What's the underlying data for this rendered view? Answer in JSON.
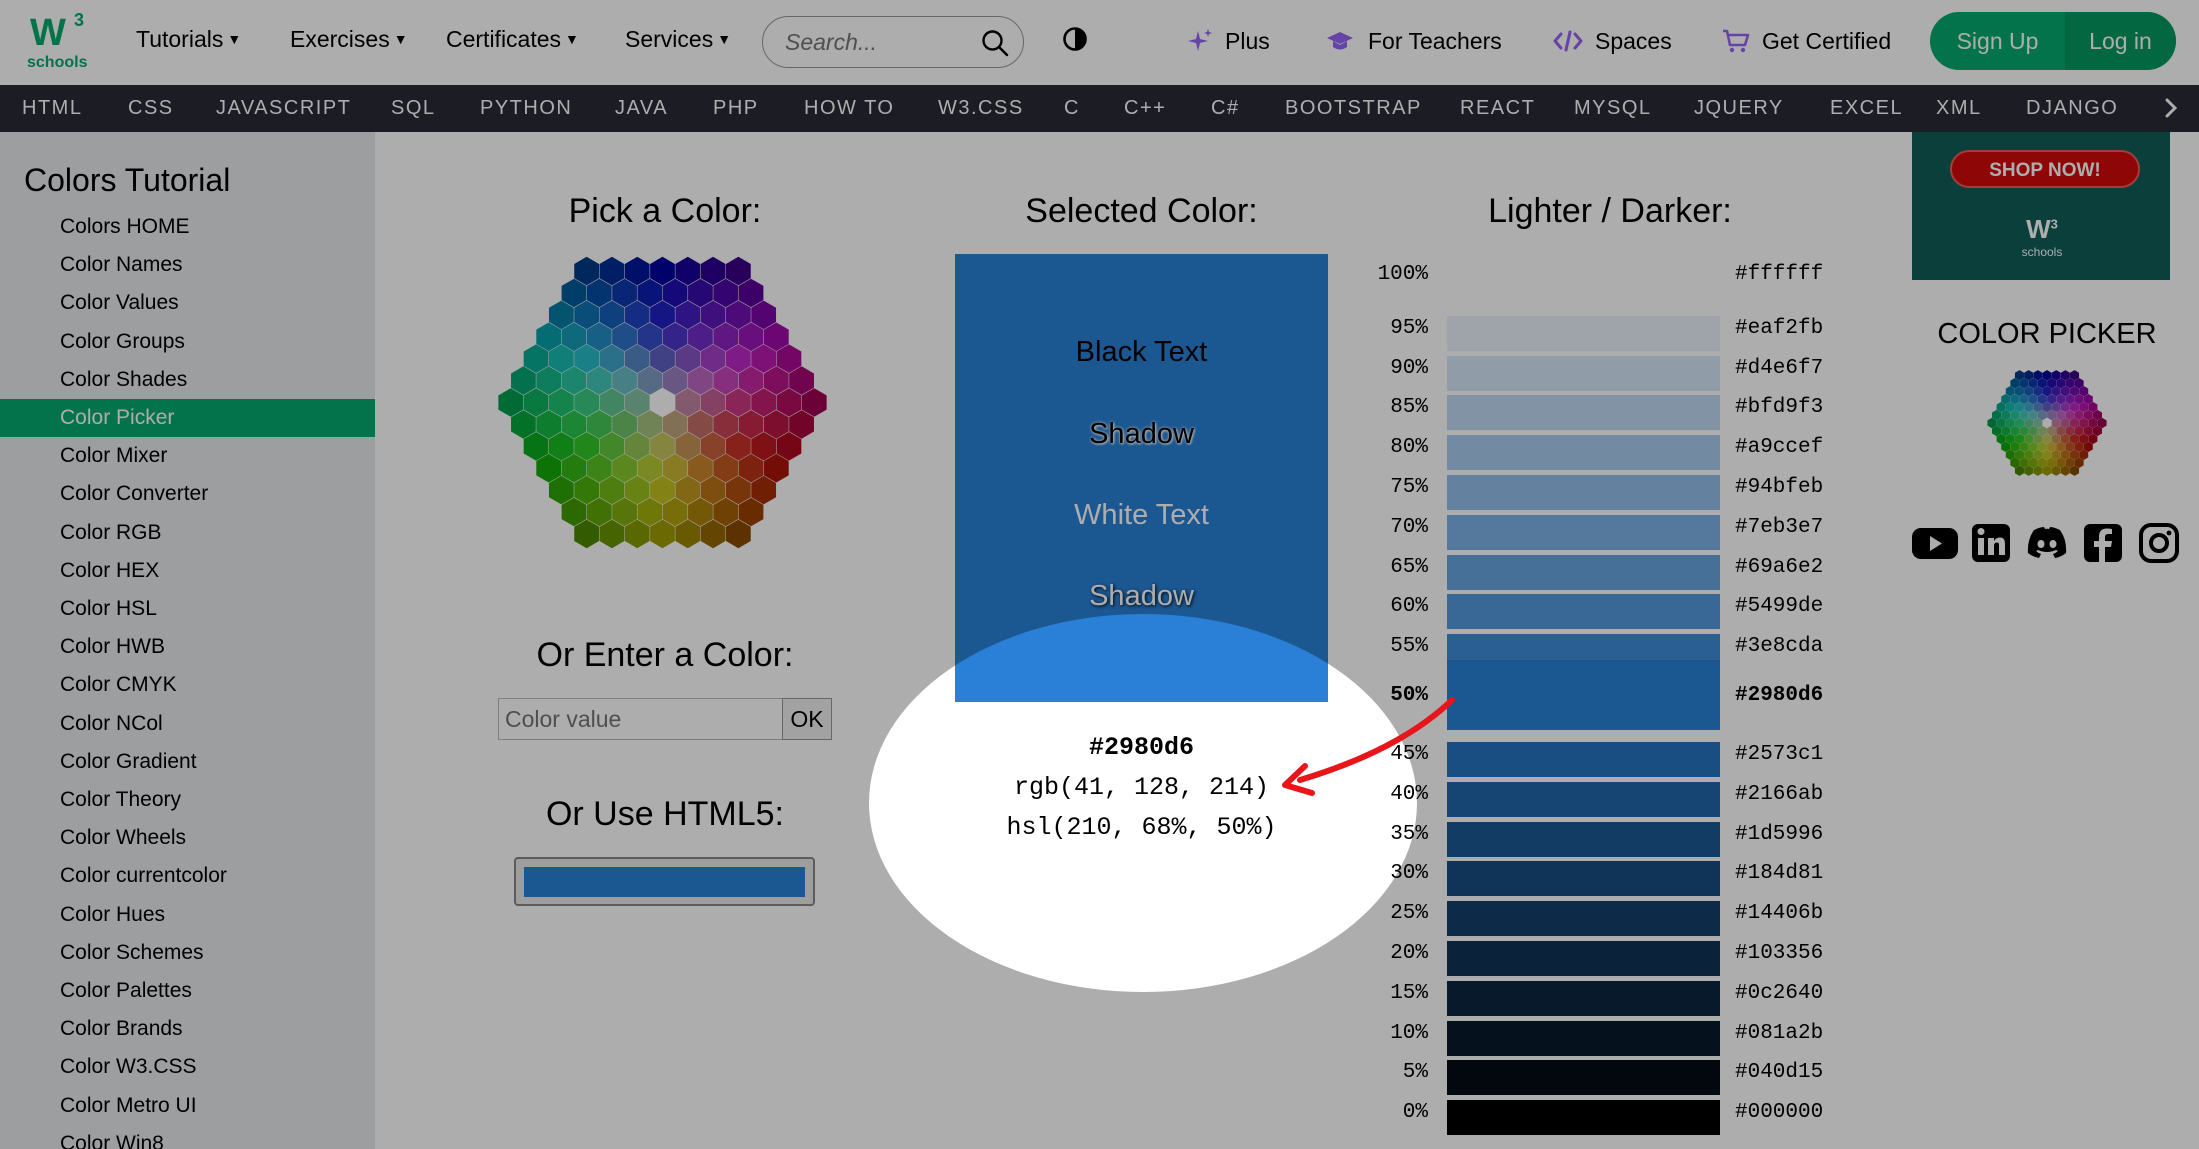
{
  "header": {
    "logo_main": "W",
    "logo_sup": "3",
    "logo_sub": "schools",
    "menus": [
      "Tutorials",
      "Exercises",
      "Certificates",
      "Services"
    ],
    "search_placeholder": "Search...",
    "links": {
      "plus": "Plus",
      "teachers": "For Teachers",
      "spaces": "Spaces",
      "certified": "Get Certified"
    },
    "signup": "Sign Up",
    "login": "Log in"
  },
  "nav": [
    "HTML",
    "CSS",
    "JAVASCRIPT",
    "SQL",
    "PYTHON",
    "JAVA",
    "PHP",
    "HOW TO",
    "W3.CSS",
    "C",
    "C++",
    "C#",
    "BOOTSTRAP",
    "REACT",
    "MYSQL",
    "JQUERY",
    "EXCEL",
    "XML",
    "DJANGO"
  ],
  "sidebar": {
    "title": "Colors Tutorial",
    "items": [
      "Colors HOME",
      "Color Names",
      "Color Values",
      "Color Groups",
      "Color Shades",
      "Color Picker",
      "Color Mixer",
      "Color Converter",
      "Color RGB",
      "Color HEX",
      "Color HSL",
      "Color HWB",
      "Color CMYK",
      "Color NCol",
      "Color Gradient",
      "Color Theory",
      "Color Wheels",
      "Color currentcolor",
      "Color Hues",
      "Color Schemes",
      "Color Palettes",
      "Color Brands",
      "Color W3.CSS",
      "Color Metro UI",
      "Color Win8"
    ],
    "active": "Color Picker"
  },
  "main": {
    "pick_heading": "Pick a Color:",
    "enter_heading": "Or Enter a Color:",
    "input_placeholder": "Color value",
    "ok_label": "OK",
    "html5_heading": "Or Use HTML5:",
    "html5_value": "#2980d6",
    "selected_heading": "Selected Color:",
    "selected_color": "#2980d6",
    "preview_texts": {
      "black": "Black Text",
      "black_shadow": "Shadow",
      "white": "White Text",
      "white_shadow": "Shadow"
    },
    "selected_hex": "#2980d6",
    "selected_rgb": "rgb(41, 128, 214)",
    "selected_hsl": "hsl(210, 68%, 50%)",
    "shades_heading": "Lighter / Darker:",
    "shades": [
      {
        "pct": "100%",
        "hex": "#ffffff"
      },
      {
        "pct": "95%",
        "hex": "#eaf2fb"
      },
      {
        "pct": "90%",
        "hex": "#d4e6f7"
      },
      {
        "pct": "85%",
        "hex": "#bfd9f3"
      },
      {
        "pct": "80%",
        "hex": "#a9ccef"
      },
      {
        "pct": "75%",
        "hex": "#94bfeb"
      },
      {
        "pct": "70%",
        "hex": "#7eb3e7"
      },
      {
        "pct": "65%",
        "hex": "#69a6e2"
      },
      {
        "pct": "60%",
        "hex": "#5499de"
      },
      {
        "pct": "55%",
        "hex": "#3e8cda"
      },
      {
        "pct": "50%",
        "hex": "#2980d6"
      },
      {
        "pct": "45%",
        "hex": "#2573c1"
      },
      {
        "pct": "40%",
        "hex": "#2166ab"
      },
      {
        "pct": "35%",
        "hex": "#1d5996"
      },
      {
        "pct": "30%",
        "hex": "#184d81"
      },
      {
        "pct": "25%",
        "hex": "#14406b"
      },
      {
        "pct": "20%",
        "hex": "#103356"
      },
      {
        "pct": "15%",
        "hex": "#0c2640"
      },
      {
        "pct": "10%",
        "hex": "#081a2b"
      },
      {
        "pct": "5%",
        "hex": "#040d15"
      },
      {
        "pct": "0%",
        "hex": "#000000"
      }
    ]
  },
  "right": {
    "ad_button": "SHOP NOW!",
    "ad_logo": "W",
    "ad_logo_sup": "3",
    "ad_logo_sub": "schools",
    "color_picker_title": "COLOR PICKER",
    "social": [
      "youtube-icon",
      "linkedin-icon",
      "discord-icon",
      "facebook-icon",
      "instagram-icon"
    ]
  },
  "colors": {
    "brand": "#04AA6D",
    "navbar": "#282A35",
    "sidebar": "#E7E9EB",
    "annotation_arrow": "#e8161b"
  }
}
